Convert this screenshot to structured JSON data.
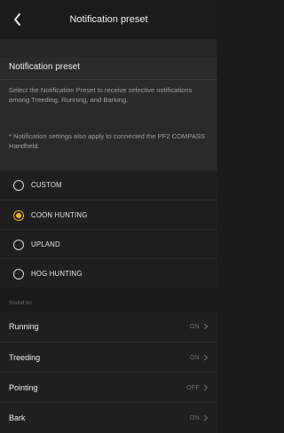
{
  "header": {
    "title": "Notification preset",
    "back_icon": "chevron-left-icon"
  },
  "info": {
    "title": "Notification preset",
    "text1": "Select the Notification Preset to receive selective notifications among Treeding, Running, and Barking.",
    "text2": "* Notification settings also apply to connected the PF2 COMPASS Handheld."
  },
  "options": [
    {
      "label": "CUSTOM",
      "selected": false
    },
    {
      "label": "COON HUNTING",
      "selected": true
    },
    {
      "label": "UPLAND",
      "selected": false
    },
    {
      "label": "HOG HUNTING",
      "selected": false
    }
  ],
  "section": {
    "label": "Sound on"
  },
  "rows": [
    {
      "label": "Running",
      "value": "ON"
    },
    {
      "label": "Treeding",
      "value": "ON"
    },
    {
      "label": "Pointing",
      "value": "OFF"
    },
    {
      "label": "Bark",
      "value": "ON"
    }
  ],
  "colors": {
    "accent": "#f0b429",
    "background": "#1a1a1a",
    "card": "#2a2a2a"
  }
}
